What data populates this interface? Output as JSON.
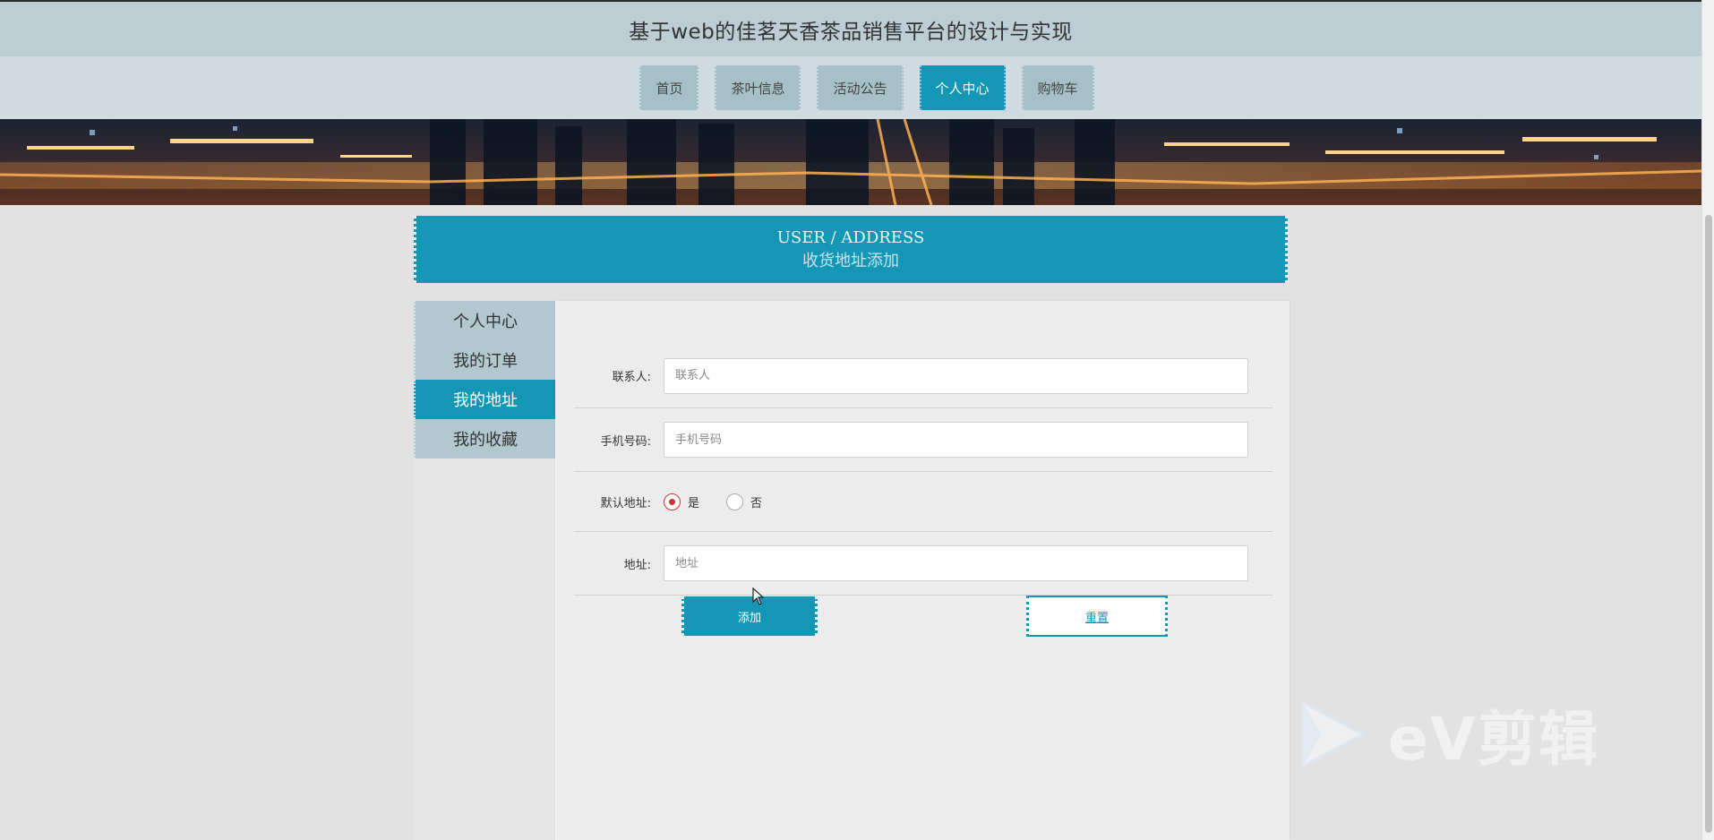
{
  "header": {
    "title": "基于web的佳茗天香茶品销售平台的设计与实现"
  },
  "nav": {
    "items": [
      {
        "label": "首页",
        "active": false
      },
      {
        "label": "茶叶信息",
        "active": false
      },
      {
        "label": "活动公告",
        "active": false
      },
      {
        "label": "个人中心",
        "active": true
      },
      {
        "label": "购物车",
        "active": false
      }
    ]
  },
  "section": {
    "title_en": "USER / ADDRESS",
    "title_zh": "收货地址添加"
  },
  "sidebar": {
    "items": [
      {
        "label": "个人中心",
        "active": false
      },
      {
        "label": "我的订单",
        "active": false
      },
      {
        "label": "我的地址",
        "active": true
      },
      {
        "label": "我的收藏",
        "active": false
      }
    ]
  },
  "form": {
    "contact": {
      "label": "联系人:",
      "placeholder": "联系人",
      "value": ""
    },
    "phone": {
      "label": "手机号码:",
      "placeholder": "手机号码",
      "value": ""
    },
    "default_address": {
      "label": "默认地址:",
      "options": [
        {
          "label": "是",
          "checked": true
        },
        {
          "label": "否",
          "checked": false
        }
      ]
    },
    "address": {
      "label": "地址:",
      "placeholder": "地址",
      "value": ""
    },
    "add_label": "添加",
    "reset_label": "重置"
  },
  "watermark": {
    "text": "eV剪辑"
  },
  "colors": {
    "accent": "#1497b4",
    "header_bg": "#bccdd3",
    "nav_bg": "#cfdbe1",
    "radio_checked": "#cc3333"
  }
}
